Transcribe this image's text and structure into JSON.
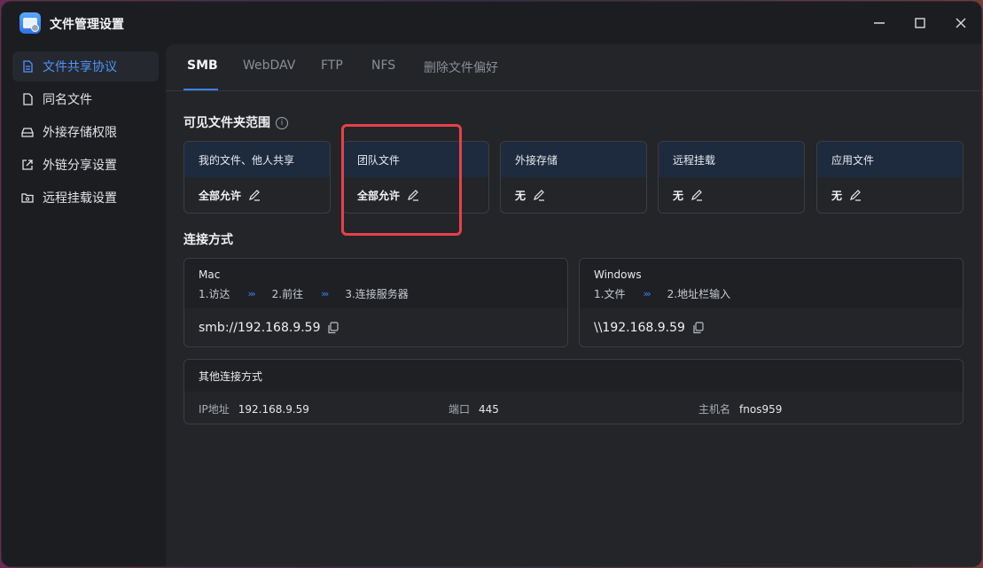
{
  "window": {
    "title": "文件管理设置"
  },
  "sidebar": {
    "items": [
      {
        "label": "文件共享协议",
        "icon": "document-icon",
        "active": true
      },
      {
        "label": "同名文件",
        "icon": "file-icon"
      },
      {
        "label": "外接存储权限",
        "icon": "drive-icon"
      },
      {
        "label": "外链分享设置",
        "icon": "share-icon"
      },
      {
        "label": "远程挂载设置",
        "icon": "folder-mount-icon"
      }
    ]
  },
  "tabs": [
    "SMB",
    "WebDAV",
    "FTP",
    "NFS",
    "删除文件偏好"
  ],
  "visible_scope": {
    "title": "可见文件夹范围",
    "cards": [
      {
        "name": "我的文件、他人共享",
        "value": "全部允许"
      },
      {
        "name": "团队文件",
        "value": "全部允许"
      },
      {
        "name": "外接存储",
        "value": "无"
      },
      {
        "name": "远程挂载",
        "value": "无"
      },
      {
        "name": "应用文件",
        "value": "无"
      }
    ]
  },
  "connection": {
    "title": "连接方式",
    "mac": {
      "name": "Mac",
      "steps": [
        "1.访达",
        "2.前往",
        "3.连接服务器"
      ],
      "address": "smb://192.168.9.59"
    },
    "windows": {
      "name": "Windows",
      "steps": [
        "1.文件",
        "2.地址栏输入"
      ],
      "address": "\\\\192.168.9.59"
    },
    "other": {
      "title": "其他连接方式",
      "ip_label": "IP地址",
      "ip": "192.168.9.59",
      "port_label": "端口",
      "port": "445",
      "host_label": "主机名",
      "host": "fnos959"
    },
    "arrow_glyph": "›››"
  },
  "colors": {
    "accent": "#3b82f6",
    "highlight": "#e8404a",
    "card_header": "#1e2a3e"
  }
}
